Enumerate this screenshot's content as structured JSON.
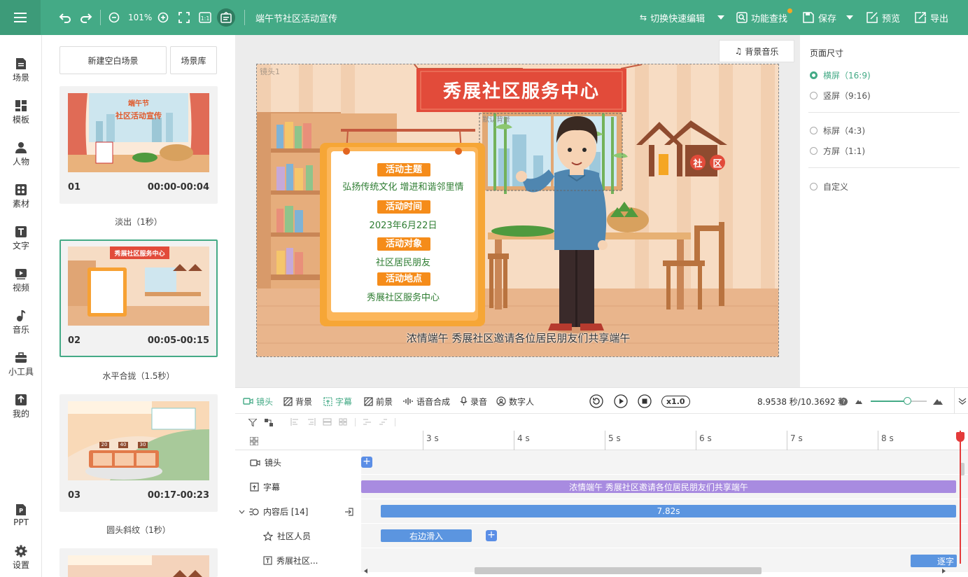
{
  "topbar": {
    "zoom": "101%",
    "doc_title": "端午节社区活动宣传",
    "quick_edit": "切换快速编辑",
    "find": "功能查找",
    "save": "保存",
    "preview": "预览",
    "export": "导出",
    "brand_color": "#44aa86"
  },
  "leftnav": {
    "items": [
      {
        "label": "场景",
        "icon": "scene-icon"
      },
      {
        "label": "模板",
        "icon": "template-icon"
      },
      {
        "label": "人物",
        "icon": "person-icon"
      },
      {
        "label": "素材",
        "icon": "material-icon"
      },
      {
        "label": "文字",
        "icon": "text-icon"
      },
      {
        "label": "视频",
        "icon": "video-icon"
      },
      {
        "label": "音乐",
        "icon": "music-icon"
      },
      {
        "label": "小工具",
        "icon": "toolbox-icon"
      },
      {
        "label": "我的",
        "icon": "upload-icon"
      }
    ],
    "ppt": "PPT",
    "settings": "设置"
  },
  "scenes": {
    "new_blank": "新建空白场景",
    "library": "场景库",
    "cards": [
      {
        "num": "01",
        "time": "00:00-00:04",
        "transition": "淡出（1秒）",
        "thumb_title1": "端午节",
        "thumb_title2": "社区活动宣传"
      },
      {
        "num": "02",
        "time": "00:05-00:15",
        "transition": "水平合拢（1.5秒）",
        "thumb_title1": "秀展社区服务中心"
      },
      {
        "num": "03",
        "time": "00:17-00:23",
        "transition": "圆头斜纹（1秒）",
        "thumb_nums": [
          "20",
          "40",
          "30"
        ]
      },
      {
        "num": "",
        "time": "",
        "transition": ""
      }
    ]
  },
  "canvas": {
    "bgm": "背景音乐",
    "shot_label": "镜头1",
    "banner": "秀展社区服务中心",
    "house_label1": "社",
    "house_label2": "区",
    "board": {
      "h1": "活动主题",
      "v1": "弘扬传统文化 增进和谐邻里情",
      "h2": "活动时间",
      "v2": "2023年6月22日",
      "h3": "活动对象",
      "v3": "社区居民朋友",
      "h4": "活动地点",
      "v4": "秀展社区服务中心"
    },
    "subtitle": "浓情端午 秀展社区邀请各位居民朋友们共享端午",
    "faint_label": "默认背景"
  },
  "page_size": {
    "title": "页面尺寸",
    "options": [
      {
        "label": "横屏（16:9)",
        "selected": true
      },
      {
        "label": "竖屏（9:16)",
        "selected": false
      },
      {
        "label": "标屏（4:3)",
        "selected": false
      },
      {
        "label": "方屏（1:1)",
        "selected": false
      },
      {
        "label": "自定义",
        "selected": false
      }
    ]
  },
  "timeline": {
    "tabs": [
      "镜头",
      "背景",
      "字幕",
      "前景",
      "语音合成",
      "录音",
      "数字人"
    ],
    "active_tab": "字幕",
    "speed": "x1.0",
    "time": "8.9538 秒/10.3692 秒",
    "ruler": [
      "3 s",
      "4 s",
      "5 s",
      "6 s",
      "7 s",
      "8 s"
    ],
    "rows": {
      "shot": "镜头",
      "subtitle": "字幕",
      "content_after": "内容后 [14]",
      "people": "社区人员",
      "text": "秀展社区..."
    },
    "clips": {
      "subtitle": "浓情端午 秀展社区邀请各位居民朋友们共享端午",
      "content": "7.82s",
      "people": "右边滑入",
      "text": "逐字"
    }
  }
}
